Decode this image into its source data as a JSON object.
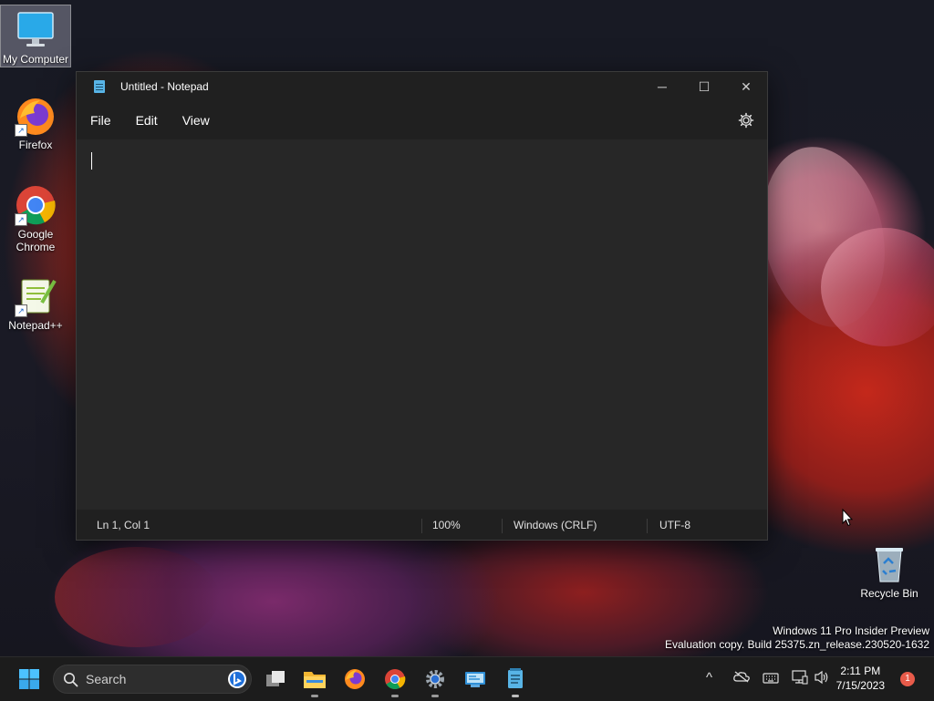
{
  "desktop": {
    "icons": [
      {
        "label": "My Computer"
      },
      {
        "label": "Firefox"
      },
      {
        "label": "Google Chrome"
      },
      {
        "label": "Notepad++"
      },
      {
        "label": "Recycle Bin"
      }
    ],
    "watermark": {
      "line1": "Windows 11 Pro Insider Preview",
      "line2": "Evaluation copy. Build 25375.zn_release.230520-1632"
    }
  },
  "notepad": {
    "title": "Untitled - Notepad",
    "window_controls": {
      "minimize": "─",
      "maximize": "☐",
      "close": "✕"
    },
    "menu": [
      {
        "label": "File"
      },
      {
        "label": "Edit"
      },
      {
        "label": "View"
      }
    ],
    "settings_icon": "gear-icon",
    "content": "",
    "status": {
      "position": "Ln 1, Col 1",
      "zoom": "100%",
      "line_ending": "Windows (CRLF)",
      "encoding": "UTF-8"
    }
  },
  "taskbar": {
    "search_placeholder": "Search",
    "apps": [
      "task-view-icon",
      "file-explorer-icon",
      "firefox-icon",
      "chrome-icon",
      "settings-icon",
      "network-tool-icon",
      "notepad-icon"
    ],
    "tray": {
      "overflow": "^"
    },
    "clock": {
      "time": "2:11 PM",
      "date": "7/15/2023"
    },
    "notification_count": "1"
  },
  "colors": {
    "accent": "#58b4e6",
    "window_bg": "#202020",
    "editor_bg": "#272727",
    "taskbar_bg": "#1c1c1c"
  }
}
